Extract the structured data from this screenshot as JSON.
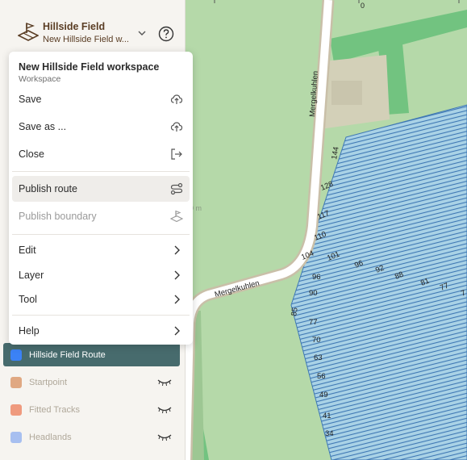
{
  "header": {
    "title": "Hillside Field",
    "subtitle": "New Hillside Field w..."
  },
  "menu": {
    "title": "New Hillside Field workspace",
    "subtitle": "Workspace",
    "items": {
      "save": "Save",
      "save_as": "Save as ...",
      "close": "Close",
      "publish_route": "Publish route",
      "publish_boundary": "Publish boundary",
      "edit": "Edit",
      "layer": "Layer",
      "tool": "Tool",
      "help": "Help"
    }
  },
  "layers": [
    {
      "name": "Hillside Field Route",
      "color": "#3b82f6",
      "active": true
    },
    {
      "name": "Startpoint",
      "color": "#e0a882",
      "active": false
    },
    {
      "name": "Fitted Tracks",
      "color": "#ef9a7e",
      "active": false
    },
    {
      "name": "Headlands",
      "color": "#a7bff0",
      "active": false
    }
  ],
  "map": {
    "road_name": "Mergelkuhlen",
    "scale_zero": "0",
    "scale_hint": "0 m",
    "row_labels": [
      "144",
      "128",
      "117",
      "110",
      "104",
      "101",
      "96",
      "92",
      "88",
      "81",
      "77",
      "7",
      "96",
      "90",
      "85",
      "77",
      "70",
      "63",
      "56",
      "49",
      "41",
      "34"
    ]
  },
  "colors": {
    "accent": "#476b6d",
    "field_fill": "#a9d2e6",
    "field_stripe": "#3f78b4",
    "grass": "#b5d9a9",
    "grass_dark": "#72c380",
    "road": "#ffffff",
    "road_edge": "#c9bfa8"
  }
}
